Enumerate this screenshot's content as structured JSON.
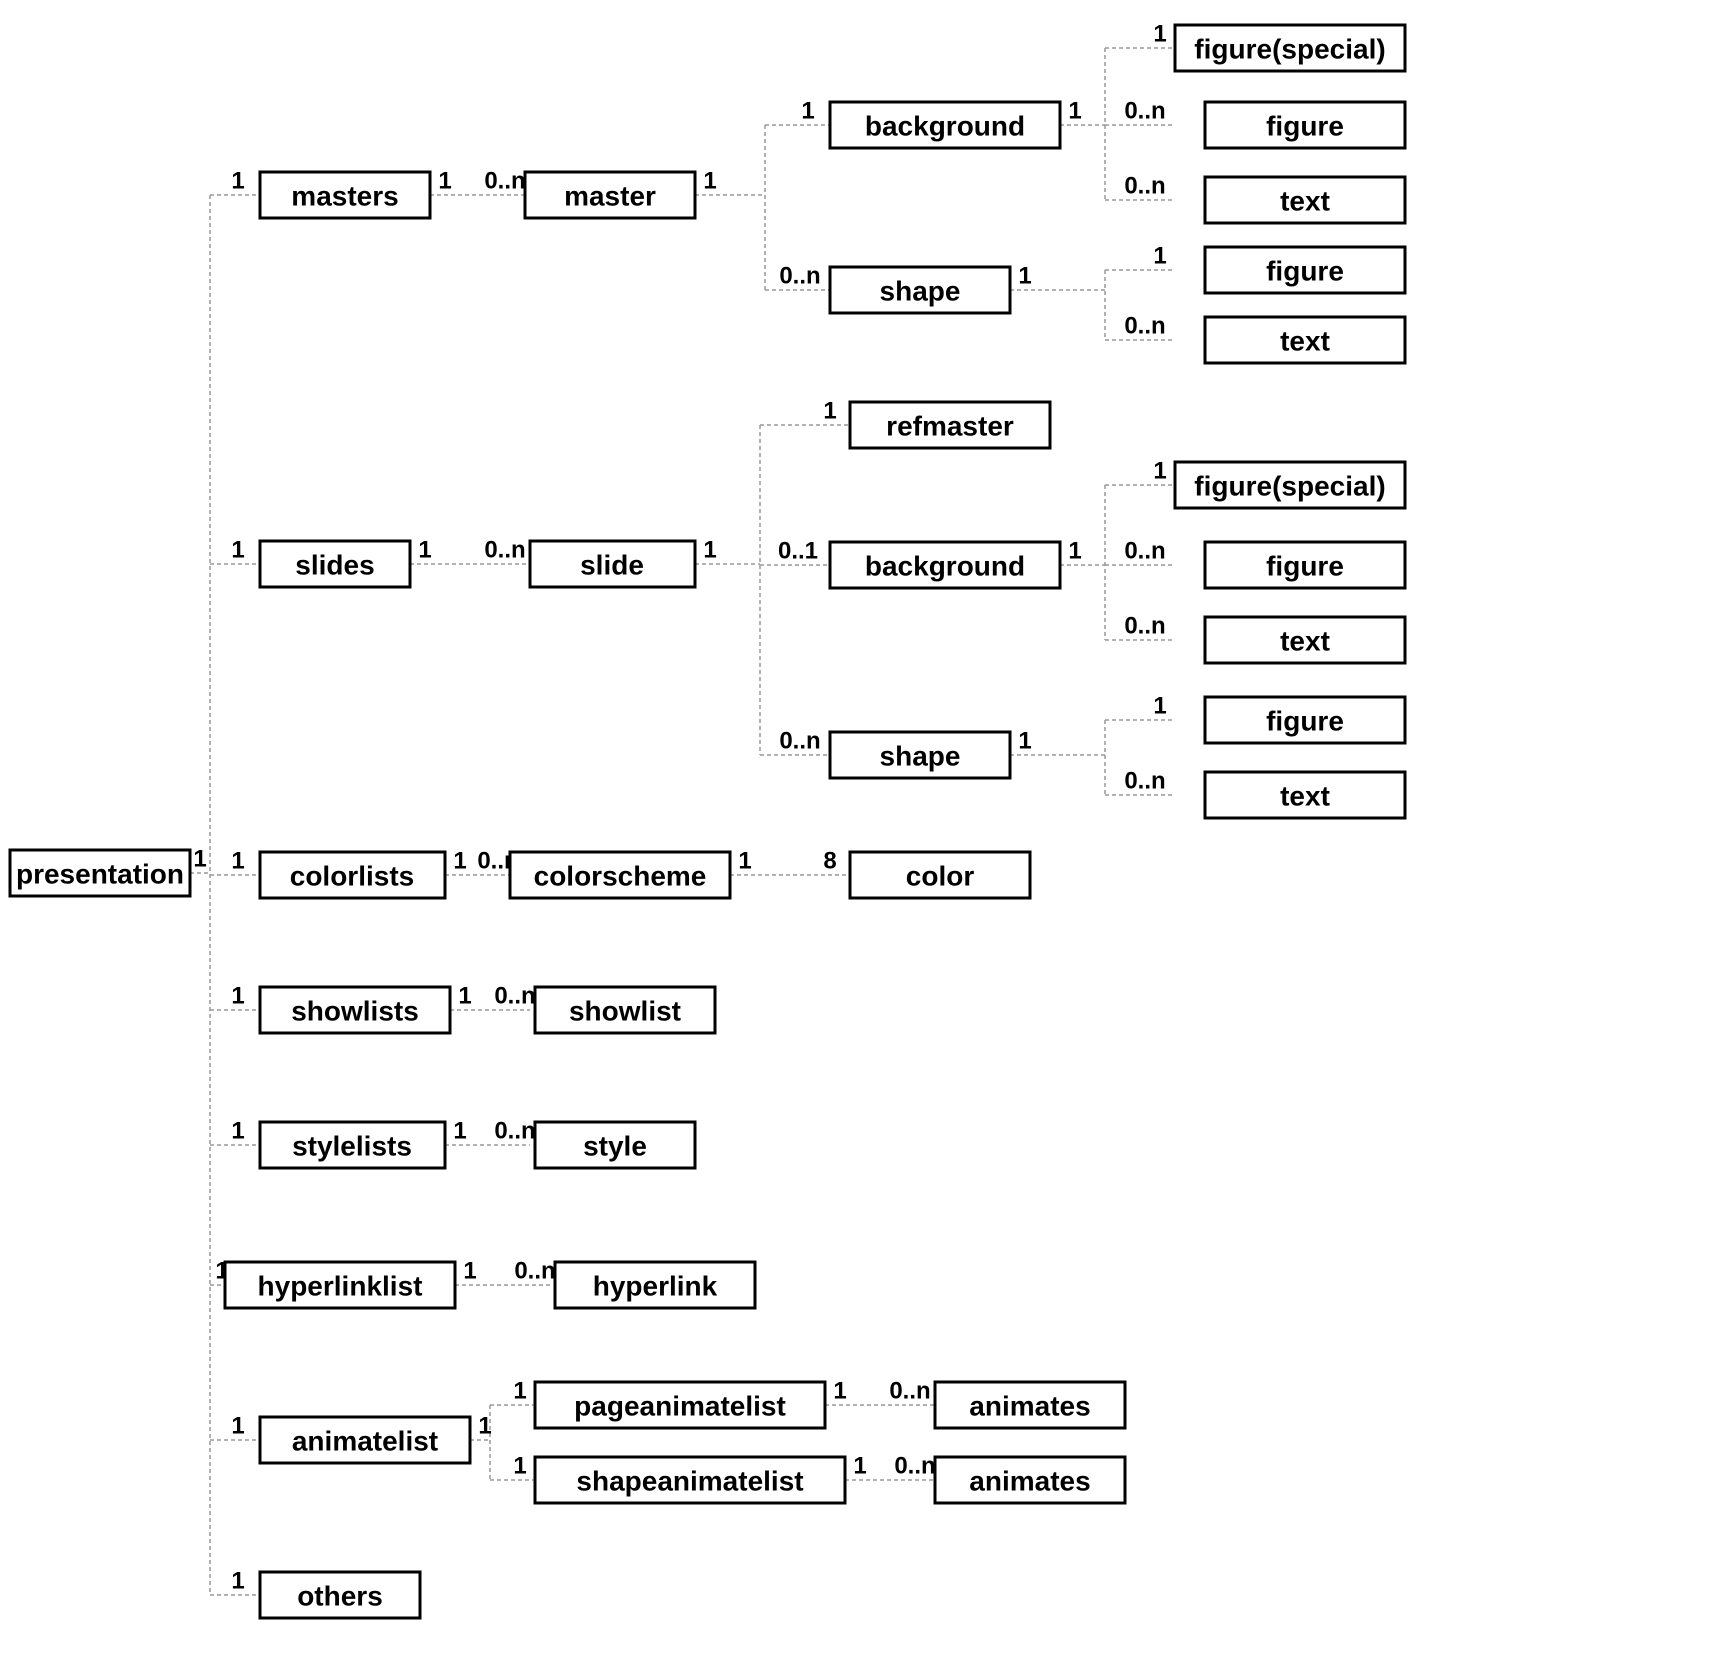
{
  "cardinality": {
    "one": "1",
    "zero_n": "0..n",
    "zero_one": "0..1",
    "eight": "8"
  },
  "nodes": {
    "presentation": "presentation",
    "masters": "masters",
    "master": "master",
    "background": "background",
    "figure_special": "figure(special)",
    "figure": "figure",
    "text": "text",
    "shape": "shape",
    "slides": "slides",
    "slide": "slide",
    "refmaster": "refmaster",
    "colorlists": "colorlists",
    "colorscheme": "colorscheme",
    "color": "color",
    "showlists": "showlists",
    "showlist": "showlist",
    "stylelists": "stylelists",
    "style": "style",
    "hyperlinklist": "hyperlinklist",
    "hyperlink": "hyperlink",
    "animatelist": "animatelist",
    "pageanimatelist": "pageanimatelist",
    "shapeanimatelist": "shapeanimatelist",
    "animates": "animates",
    "others": "others"
  }
}
